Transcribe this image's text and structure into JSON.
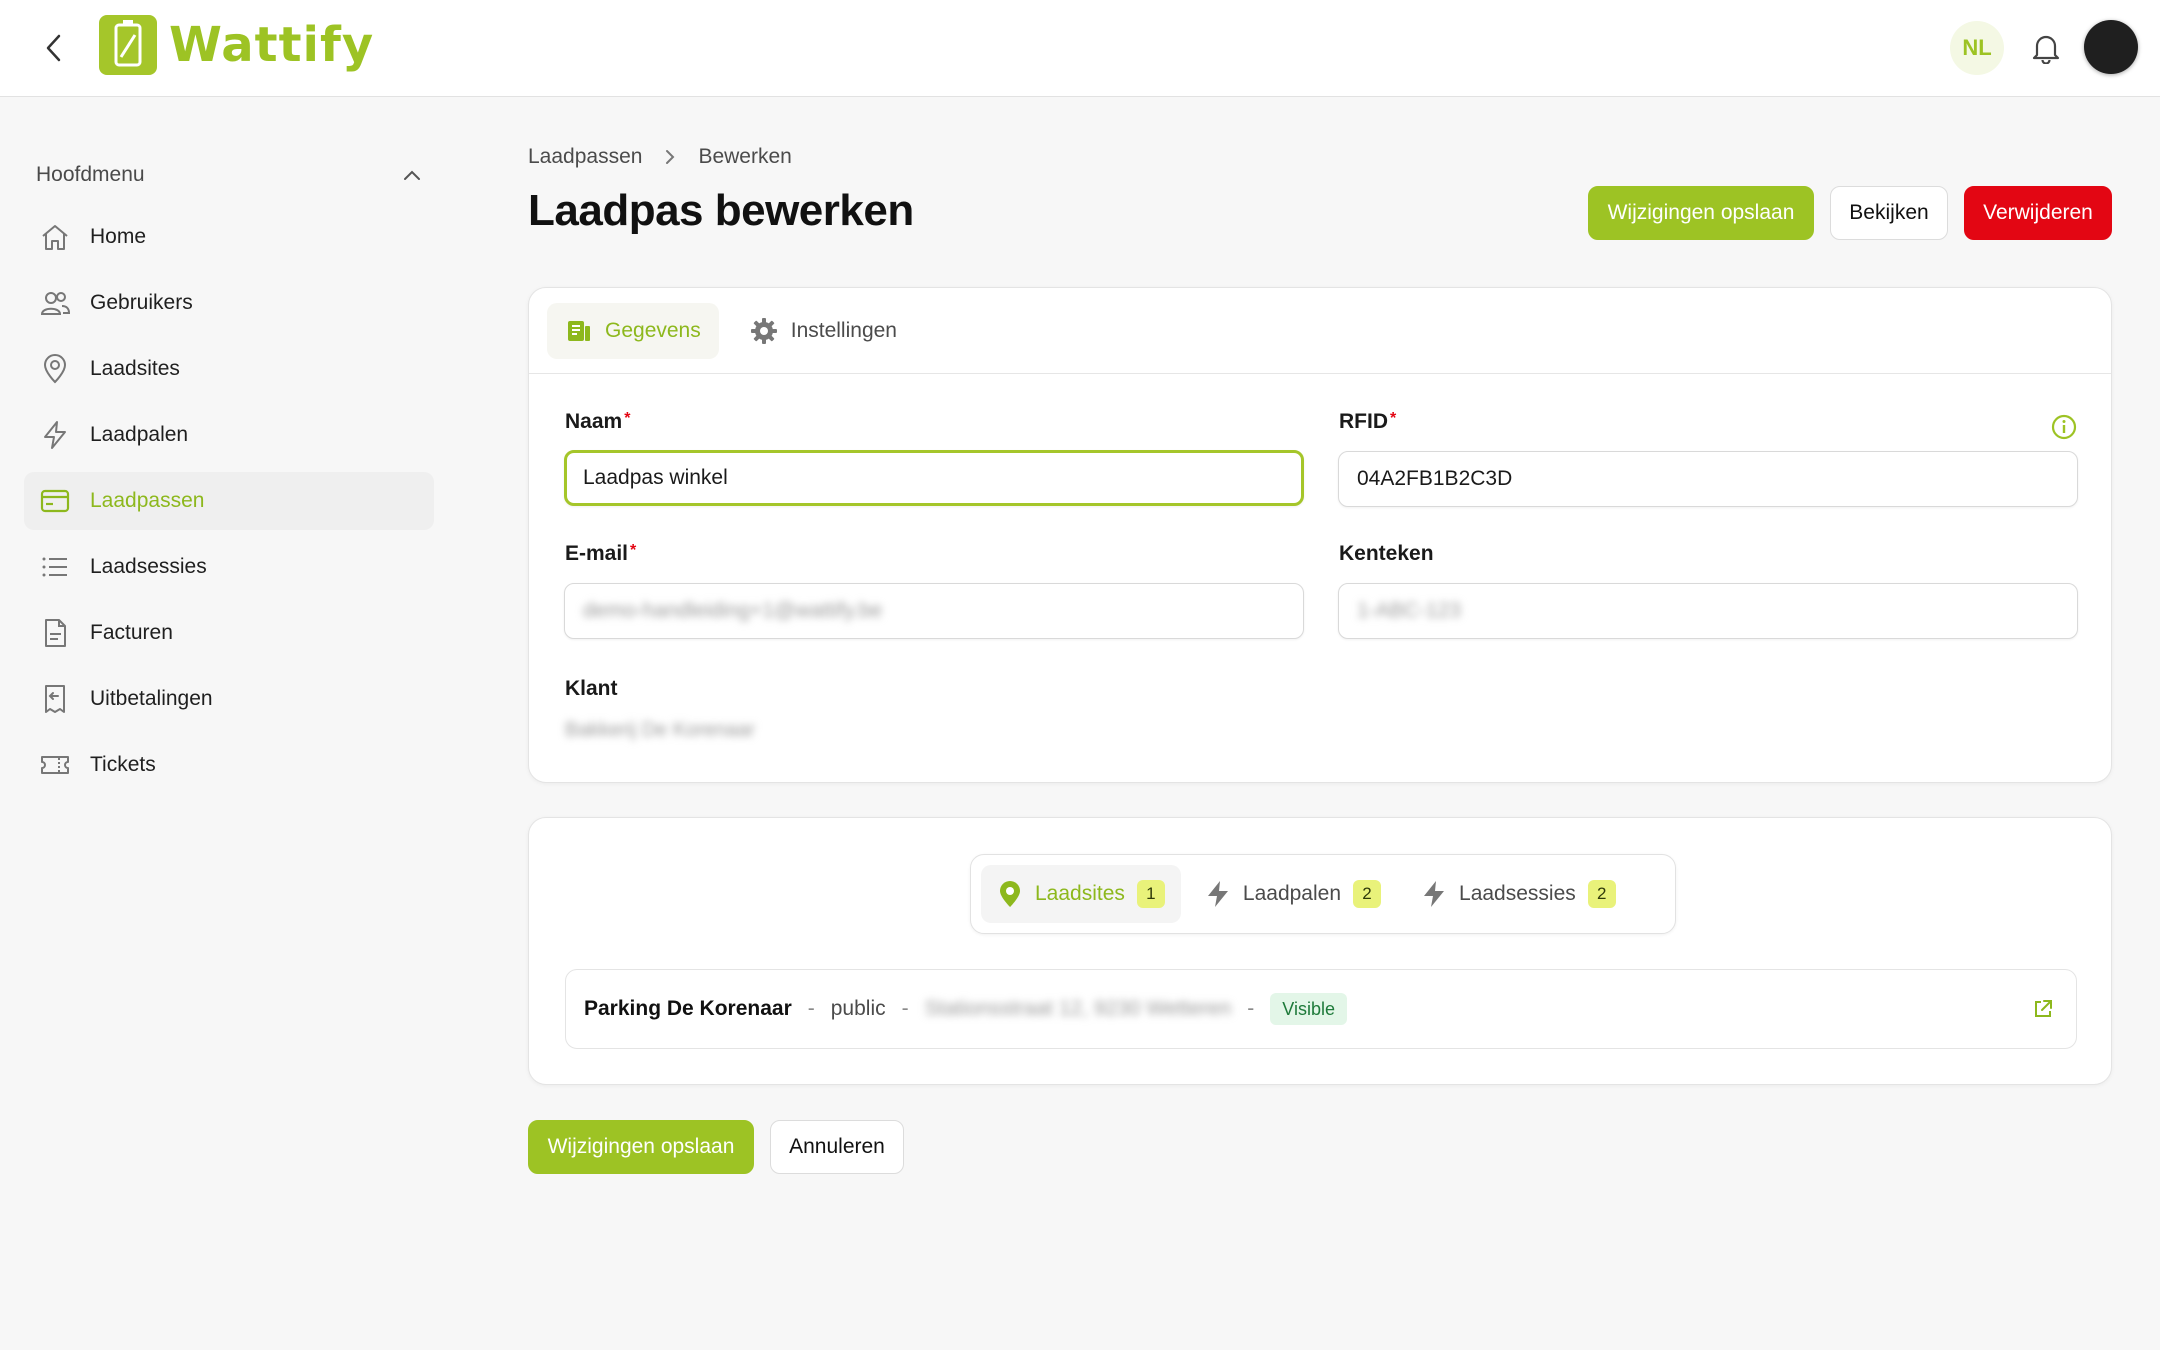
{
  "header": {
    "logo_text": "Wattify",
    "language": "NL",
    "brand_color": "#9dc324"
  },
  "sidebar": {
    "section_title": "Hoofdmenu",
    "items": [
      {
        "label": "Home",
        "icon": "home-icon"
      },
      {
        "label": "Gebruikers",
        "icon": "users-icon"
      },
      {
        "label": "Laadsites",
        "icon": "map-pin-icon"
      },
      {
        "label": "Laadpalen",
        "icon": "lightning-icon"
      },
      {
        "label": "Laadpassen",
        "icon": "card-icon",
        "active": true
      },
      {
        "label": "Laadsessies",
        "icon": "list-icon"
      },
      {
        "label": "Facturen",
        "icon": "invoice-icon"
      },
      {
        "label": "Uitbetalingen",
        "icon": "receipt-icon"
      },
      {
        "label": "Tickets",
        "icon": "ticket-icon"
      }
    ]
  },
  "breadcrumb": [
    "Laadpassen",
    "Bewerken"
  ],
  "page": {
    "title": "Laadpas bewerken"
  },
  "actions": {
    "save": "Wijzigingen opslaan",
    "view": "Bekijken",
    "delete": "Verwijderen",
    "cancel": "Annuleren"
  },
  "form": {
    "tabs": [
      "Gegevens",
      "Instellingen"
    ],
    "name_label": "Naam",
    "name_value": "Laadpas winkel",
    "rfid_label": "RFID",
    "rfid_value": "04A2FB1B2C3D",
    "email_label": "E-mail",
    "email_value": "demo-handleiding+1@wattify.be",
    "plate_label": "Kenteken",
    "plate_value": "1-ABC-123",
    "customer_label": "Klant",
    "customer_value": "Bakkerij De Korenaar"
  },
  "related": {
    "tabs": [
      {
        "label": "Laadsites",
        "count": "1",
        "icon": "map-pin-icon"
      },
      {
        "label": "Laadpalen",
        "count": "2",
        "icon": "lightning-icon"
      },
      {
        "label": "Laadsessies",
        "count": "2",
        "icon": "lightning-icon"
      }
    ],
    "site": {
      "name": "Parking De Korenaar",
      "type": "public",
      "address": "Stationsstraat 12, 9230 Wetteren",
      "status": "Visible"
    }
  }
}
